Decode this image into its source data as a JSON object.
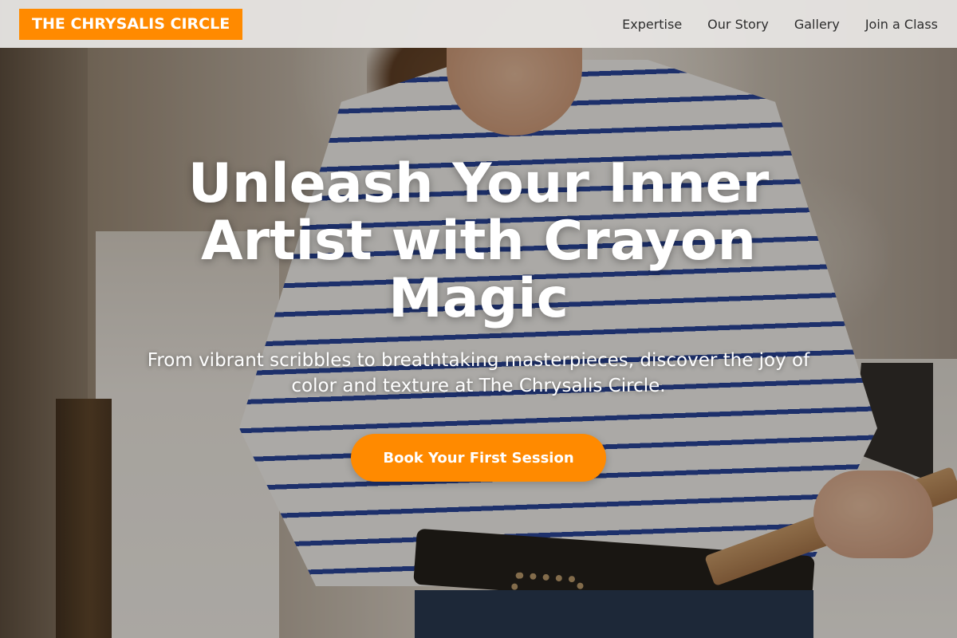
{
  "header": {
    "brand": "THE CHRYSALIS CIRCLE",
    "nav": [
      {
        "label": "Expertise"
      },
      {
        "label": "Our Story"
      },
      {
        "label": "Gallery"
      },
      {
        "label": "Join a Class"
      }
    ]
  },
  "hero": {
    "title": "Unleash Your Inner Artist with Crayon Magic",
    "subtitle": "From vibrant scribbles to breathtaking masterpieces, discover the joy of color and texture at The Chrysalis Circle.",
    "cta_label": "Book Your First Session",
    "background_image": "woman-in-striped-shirt-holding-art-board"
  },
  "colors": {
    "accent": "#ff8a00",
    "header_bg": "#e8e6e3",
    "nav_text": "#2d2d2d",
    "hero_text": "#ffffff"
  }
}
